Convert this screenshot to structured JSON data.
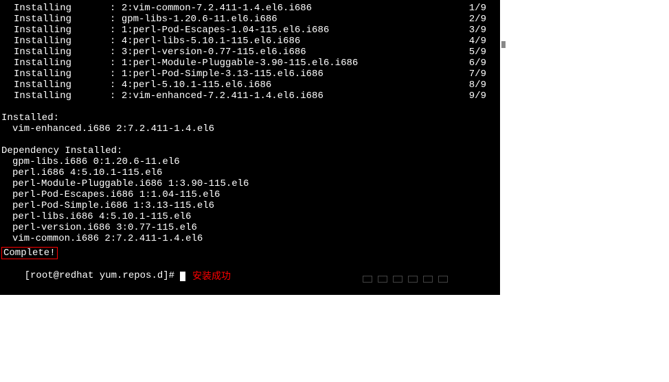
{
  "installing": [
    {
      "label": "Installing",
      "sep": ": ",
      "pkg": "2:vim-common-7.2.411-1.4.el6.i686",
      "count": "1/9"
    },
    {
      "label": "Installing",
      "sep": ": ",
      "pkg": "gpm-libs-1.20.6-11.el6.i686",
      "count": "2/9"
    },
    {
      "label": "Installing",
      "sep": ": ",
      "pkg": "1:perl-Pod-Escapes-1.04-115.el6.i686",
      "count": "3/9"
    },
    {
      "label": "Installing",
      "sep": ": ",
      "pkg": "4:perl-libs-5.10.1-115.el6.i686",
      "count": "4/9"
    },
    {
      "label": "Installing",
      "sep": ": ",
      "pkg": "3:perl-version-0.77-115.el6.i686",
      "count": "5/9"
    },
    {
      "label": "Installing",
      "sep": ": ",
      "pkg": "1:perl-Module-Pluggable-3.90-115.el6.i686",
      "count": "6/9"
    },
    {
      "label": "Installing",
      "sep": ": ",
      "pkg": "1:perl-Pod-Simple-3.13-115.el6.i686",
      "count": "7/9"
    },
    {
      "label": "Installing",
      "sep": ": ",
      "pkg": "4:perl-5.10.1-115.el6.i686",
      "count": "8/9"
    },
    {
      "label": "Installing",
      "sep": ": ",
      "pkg": "2:vim-enhanced-7.2.411-1.4.el6.i686",
      "count": "9/9"
    }
  ],
  "installed_header": "Installed:",
  "installed_items": [
    "vim-enhanced.i686 2:7.2.411-1.4.el6"
  ],
  "dependency_header": "Dependency Installed:",
  "dependency_items": [
    "gpm-libs.i686 0:1.20.6-11.el6",
    "perl.i686 4:5.10.1-115.el6",
    "perl-Module-Pluggable.i686 1:3.90-115.el6",
    "perl-Pod-Escapes.i686 1:1.04-115.el6",
    "perl-Pod-Simple.i686 1:3.13-115.el6",
    "perl-libs.i686 4:5.10.1-115.el6",
    "perl-version.i686 3:0.77-115.el6",
    "vim-common.i686 2:7.2.411-1.4.el6"
  ],
  "complete_text": "Complete!",
  "prompt": "[root@redhat yum.repos.d]# ",
  "annotation": "安装成功"
}
